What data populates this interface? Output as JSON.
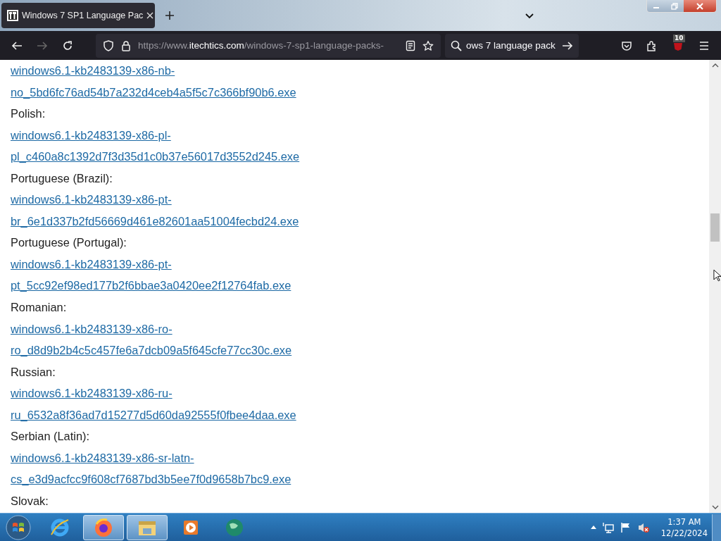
{
  "tabs": [
    {
      "title": "Windows 7 SP1 Language Pac",
      "selected": true
    }
  ],
  "toolbar": {
    "url_host_prefix": "https://www.",
    "url_host": "itechtics.com",
    "url_path": "/windows-7-sp1-language-packs-",
    "search_value": "ows 7 language pack",
    "extension_badge": "10"
  },
  "content": [
    {
      "kind": "link",
      "text": "windows6.1-kb2483139-x86-nb-no_5bd6fc76ad54b7a232d4ceb4a5f5c7c366bf90b6.exe"
    },
    {
      "kind": "label",
      "text": "Polish:"
    },
    {
      "kind": "link",
      "text": "windows6.1-kb2483139-x86-pl-pl_c460a8c1392d7f3d35d1c0b37e56017d3552d245.exe"
    },
    {
      "kind": "label",
      "text": "Portuguese (Brazil):"
    },
    {
      "kind": "link",
      "text": "windows6.1-kb2483139-x86-pt-br_6e1d337b2fd56669d461e82601aa51004fecbd24.exe"
    },
    {
      "kind": "label",
      "text": "Portuguese (Portugal):"
    },
    {
      "kind": "link",
      "text": "windows6.1-kb2483139-x86-pt-pt_5cc92ef98ed177b2f6bbae3a0420ee2f12764fab.exe"
    },
    {
      "kind": "label",
      "text": "Romanian:"
    },
    {
      "kind": "link",
      "text": "windows6.1-kb2483139-x86-ro-ro_d8d9b2b4c5c457fe6a7dcb09a5f645cfe77cc30c.exe"
    },
    {
      "kind": "label",
      "text": "Russian:"
    },
    {
      "kind": "link",
      "text": "windows6.1-kb2483139-x86-ru-ru_6532a8f36ad7d15277d5d60da92555f0fbee4daa.exe"
    },
    {
      "kind": "label",
      "text": "Serbian (Latin):"
    },
    {
      "kind": "link",
      "text": "windows6.1-kb2483139-x86-sr-latn-cs_e3d9acfcc9f608cf7687bd3b5ee7f0d9658b7bc9.exe"
    },
    {
      "kind": "label",
      "text": "Slovak:"
    }
  ],
  "taskbar": {
    "time": "1:37 AM",
    "date": "12/22/2024"
  }
}
